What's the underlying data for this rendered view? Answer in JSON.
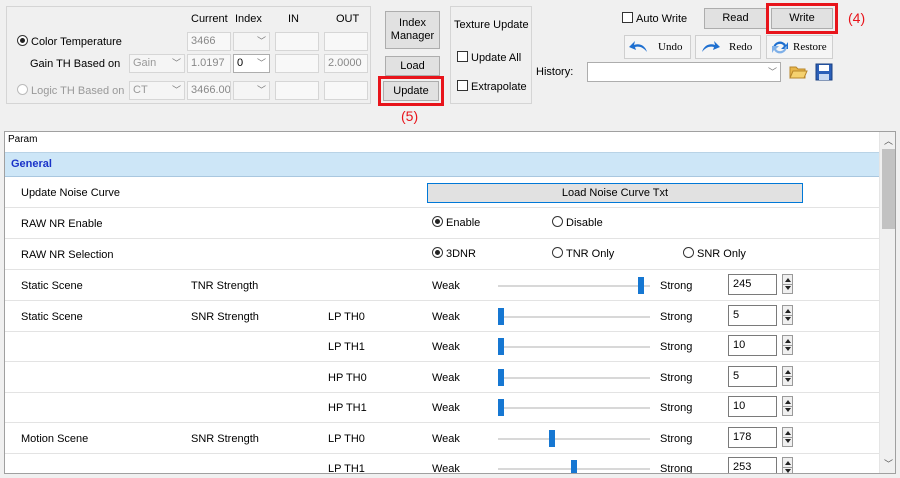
{
  "top": {
    "headers": {
      "current": "Current",
      "index": "Index",
      "in": "IN",
      "out": "OUT"
    },
    "color_temperature": {
      "label": "Color Temperature",
      "current": "3466"
    },
    "gain_th": {
      "label": "Gain TH Based on",
      "combo": "Gain",
      "current": "1.0197",
      "index": "0",
      "out": "2.0000"
    },
    "logic_th": {
      "label": "Logic TH Based on",
      "combo": "CT",
      "current": "3466.00"
    },
    "buttons": {
      "index_manager_1": "Index",
      "index_manager_2": "Manager",
      "load": "Load",
      "update": "Update"
    },
    "texture": {
      "title": "Texture Update",
      "update_all": "Update All",
      "extrapolate": "Extrapolate"
    },
    "auto_write": "Auto Write",
    "read": "Read",
    "write": "Write",
    "undo": "Undo",
    "redo": "Redo",
    "restore": "Restore",
    "history_label": "History:",
    "annotations": {
      "write": "(4)",
      "update": "(5)"
    }
  },
  "colors": {
    "annotation_red": "#e8141b",
    "section_bg": "#cde6f7",
    "section_text": "#1a33c8",
    "slider_thumb": "#1677d2"
  },
  "panel": {
    "header": "Param",
    "section": "General",
    "update_noise_curve": {
      "label": "Update Noise Curve",
      "button": "Load Noise Curve Txt"
    },
    "raw_nr_enable": {
      "label": "RAW NR Enable",
      "opt1": "Enable",
      "opt2": "Disable"
    },
    "raw_nr_selection": {
      "label": "RAW NR Selection",
      "opt1": "3DNR",
      "opt2": "TNR Only",
      "opt3": "SNR Only"
    },
    "weak": "Weak",
    "strong": "Strong",
    "sliders": [
      {
        "c1": "Static Scene",
        "c2": "TNR Strength",
        "c3": "",
        "value": "245",
        "level": 0.96
      },
      {
        "c1": "Static Scene",
        "c2": "SNR Strength",
        "c3": "LP TH0",
        "value": "5",
        "level": 0.0
      },
      {
        "c1": "",
        "c2": "",
        "c3": "LP TH1",
        "value": "10",
        "level": 0.0
      },
      {
        "c1": "",
        "c2": "",
        "c3": "HP TH0",
        "value": "5",
        "level": 0.0
      },
      {
        "c1": "",
        "c2": "",
        "c3": "HP TH1",
        "value": "10",
        "level": 0.0
      },
      {
        "c1": "Motion Scene",
        "c2": "SNR Strength",
        "c3": "LP TH0",
        "value": "178",
        "level": 0.35
      },
      {
        "c1": "",
        "c2": "",
        "c3": "LP TH1",
        "value": "253",
        "level": 0.5
      }
    ]
  }
}
